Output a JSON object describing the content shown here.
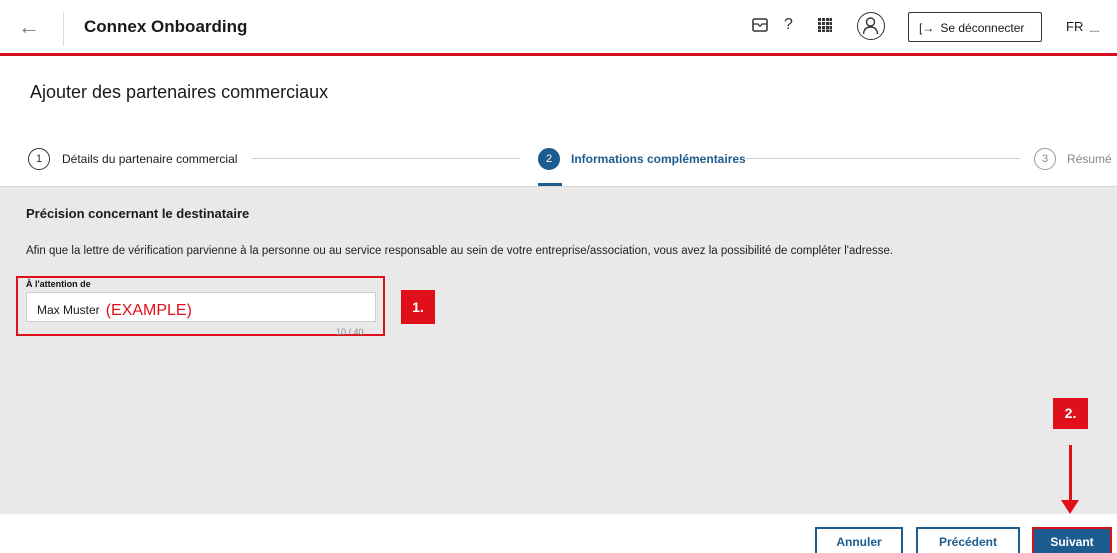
{
  "header": {
    "back_icon": "arrow-left-icon",
    "title": "Connex Onboarding",
    "mail_icon": "mail-icon",
    "help_icon": "?",
    "apps_icon": "grid-apps-icon",
    "avatar_icon": "user-avatar-icon",
    "logout_label": "Se déconnecter",
    "language": "FR",
    "accent_color": "#d50c1e"
  },
  "page": {
    "title": "Ajouter des partenaires commerciaux"
  },
  "stepper": {
    "steps": [
      {
        "number": "1",
        "label": "Détails du partenaire commercial",
        "state": "done"
      },
      {
        "number": "2",
        "label": "Informations complémentaires",
        "state": "active"
      },
      {
        "number": "3",
        "label": "Résumé",
        "state": "upcoming"
      }
    ],
    "active_color": "#1d5c8f"
  },
  "section": {
    "title": "Précision concernant le destinataire",
    "description": "Afin que la lettre de vérification parvienne à la personne ou au service responsable au sein de votre entreprise/association, vous avez la possibilité de compléter l'adresse.",
    "field": {
      "label": "À l'attention de",
      "value": "Max Muster",
      "counter": "10 / 40"
    }
  },
  "annotations": {
    "example_text": "(EXAMPLE)",
    "badge_1": "1.",
    "badge_2": "2.",
    "color": "#e0101b"
  },
  "footer": {
    "cancel_label": "Annuler",
    "previous_label": "Précédent",
    "next_label": "Suivant"
  }
}
